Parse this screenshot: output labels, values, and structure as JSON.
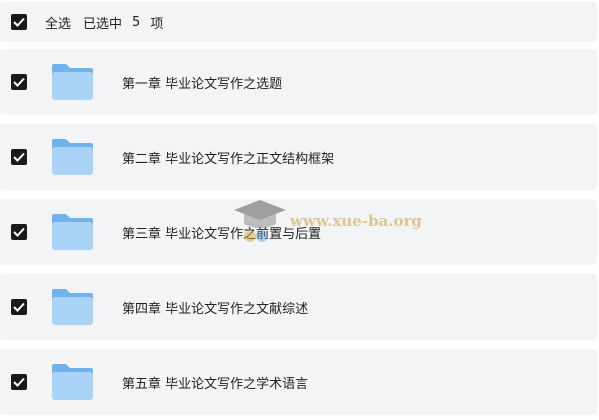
{
  "header": {
    "select_all_label": "全选",
    "selected_label": "已选中",
    "selected_count": "5",
    "selected_unit": "项"
  },
  "rows": [
    {
      "label": "第一章 毕业论文写作之选题",
      "icon": "folder-icon"
    },
    {
      "label": "第二章 毕业论文写作之正文结构框架",
      "icon": "folder-icon"
    },
    {
      "label": "第三章 毕业论文写作之前置与后置",
      "icon": "folder-icon"
    },
    {
      "label": "第四章 毕业论文写作之文献综述",
      "icon": "folder-icon"
    },
    {
      "label": "第五章 毕业论文写作之学术语言",
      "icon": "folder-icon"
    }
  ],
  "watermark": {
    "text": "www.xue-ba.org"
  },
  "colors": {
    "row_bg": "#f3f4f6",
    "checkbox": "#1a1a1a",
    "folder_light": "#a9d3f7",
    "folder_dark": "#6fb2ee"
  }
}
